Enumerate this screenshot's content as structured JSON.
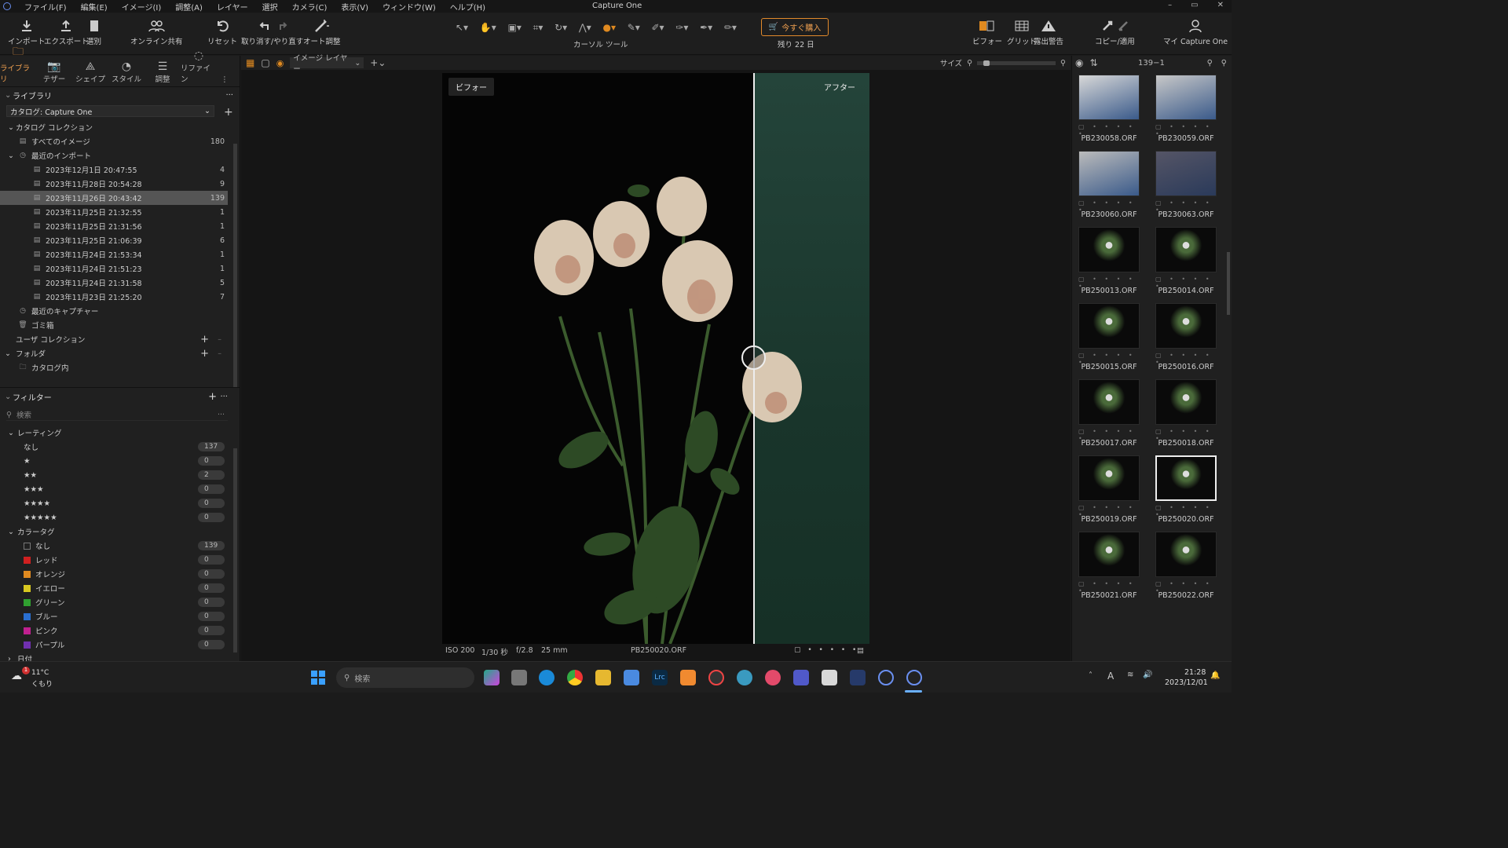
{
  "app": {
    "title": "Capture One"
  },
  "menu": [
    "ファイル(F)",
    "編集(E)",
    "イメージ(I)",
    "調整(A)",
    "レイヤー",
    "選択",
    "カメラ(C)",
    "表示(V)",
    "ウィンドウ(W)",
    "ヘルプ(H)"
  ],
  "window_controls": [
    "–",
    "▭",
    "✕"
  ],
  "toolbar": {
    "import": "インポート",
    "export": "エクスポート",
    "select": "選別",
    "share": "オンライン共有",
    "reset": "リセット",
    "undo_redo": "取り消す/やり直す",
    "auto": "オート調整",
    "cursor_tools": "カーソル ツール",
    "buy": "今すぐ購入",
    "days_left": "残り 22 日",
    "before": "ビフォー",
    "grid": "グリッド",
    "exposure": "露出警告",
    "copy_apply": "コピー/適用",
    "my": "マイ Capture One"
  },
  "tool_tabs": [
    "ライブラリ",
    "テザー",
    "シェイプ",
    "スタイル",
    "調整",
    "リファイン"
  ],
  "library": {
    "title": "ライブラリ",
    "catalog": "カタログ: Capture One",
    "catalog_collection": "カタログ コレクション",
    "all_images": "すべてのイメージ",
    "all_count": "180",
    "recent_imports": "最近のインポート",
    "imports": [
      {
        "label": "2023年12月1日 20:47:55",
        "count": "4"
      },
      {
        "label": "2023年11月28日 20:54:28",
        "count": "9"
      },
      {
        "label": "2023年11月26日 20:43:42",
        "count": "139"
      },
      {
        "label": "2023年11月25日 21:32:55",
        "count": "1"
      },
      {
        "label": "2023年11月25日 21:31:56",
        "count": "1"
      },
      {
        "label": "2023年11月25日 21:06:39",
        "count": "6"
      },
      {
        "label": "2023年11月24日 21:53:34",
        "count": "1"
      },
      {
        "label": "2023年11月24日 21:51:23",
        "count": "1"
      },
      {
        "label": "2023年11月24日 21:31:58",
        "count": "5"
      },
      {
        "label": "2023年11月23日 21:25:20",
        "count": "7"
      }
    ],
    "recent_captures": "最近のキャプチャー",
    "trash": "ゴミ箱",
    "user_collection": "ユーザ コレクション",
    "folders": "フォルダ",
    "in_catalog": "カタログ内"
  },
  "filters": {
    "title": "フィルター",
    "search_placeholder": "検索",
    "rating_title": "レーティング",
    "ratings": [
      {
        "label": "なし",
        "count": "137"
      },
      {
        "label": "★",
        "count": "0"
      },
      {
        "label": "★★",
        "count": "2"
      },
      {
        "label": "★★★",
        "count": "0"
      },
      {
        "label": "★★★★",
        "count": "0"
      },
      {
        "label": "★★★★★",
        "count": "0"
      }
    ],
    "color_title": "カラータグ",
    "colors": [
      {
        "label": "なし",
        "count": "139",
        "color": "#202020"
      },
      {
        "label": "レッド",
        "count": "0",
        "color": "#d02020"
      },
      {
        "label": "オレンジ",
        "count": "0",
        "color": "#e08a20"
      },
      {
        "label": "イエロー",
        "count": "0",
        "color": "#d8c820"
      },
      {
        "label": "グリーン",
        "count": "0",
        "color": "#30a030"
      },
      {
        "label": "ブルー",
        "count": "0",
        "color": "#2a6fd0"
      },
      {
        "label": "ピンク",
        "count": "0",
        "color": "#c02090"
      },
      {
        "label": "パープル",
        "count": "0",
        "color": "#7030b0"
      }
    ],
    "date_title": "日付"
  },
  "viewer": {
    "layer": "イメージ レイヤー",
    "size": "サイズ",
    "before": "ビフォー",
    "after": "アフター",
    "iso": "ISO 200",
    "shutter": "1/30 秒",
    "aperture": "f/2.8",
    "focal": "25 mm",
    "filename": "PB250020.ORF"
  },
  "browser": {
    "counter": "139−1",
    "thumbs": [
      "PB230058.ORF",
      "PB230059.ORF",
      "PB230060.ORF",
      "PB230063.ORF",
      "PB250013.ORF",
      "PB250014.ORF",
      "PB250015.ORF",
      "PB250016.ORF",
      "PB250017.ORF",
      "PB250018.ORF",
      "PB250019.ORF",
      "PB250020.ORF",
      "PB250021.ORF",
      "PB250022.ORF"
    ]
  },
  "taskbar": {
    "temp": "11°C",
    "weather": "くもり",
    "search": "検索",
    "time": "21:28",
    "date": "2023/12/01",
    "badge": "1"
  }
}
